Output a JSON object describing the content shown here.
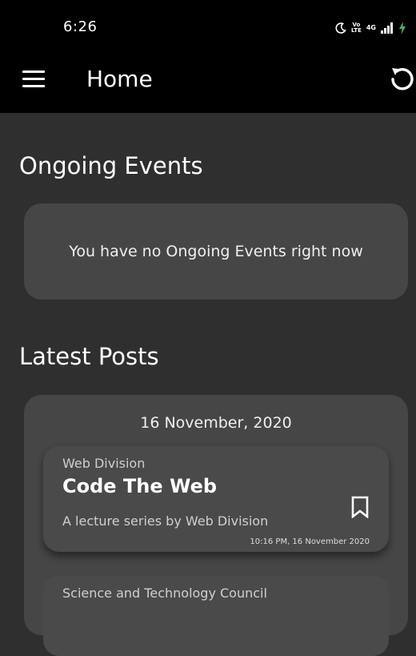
{
  "status_bar": {
    "time": "6:26",
    "icons": [
      "moon-icon",
      "volte-icon",
      "4g-icon",
      "signal-icon",
      "charging-icon"
    ],
    "volte_line1": "Vo",
    "volte_line2": "LTE",
    "network": "4G"
  },
  "app_bar": {
    "title": "Home"
  },
  "ongoing": {
    "section_title": "Ongoing Events",
    "empty_message": "You have no Ongoing Events right now"
  },
  "latest": {
    "section_title": "Latest Posts",
    "date": "16 November, 2020",
    "posts": [
      {
        "division": "Web Division",
        "title": "Code The Web",
        "description": "A lecture series by Web Division",
        "timestamp": "10:16 PM, 16 November 2020"
      },
      {
        "division": "Science and Technology Council"
      }
    ]
  },
  "colors": {
    "background": "#2f2f2f",
    "bar": "#000000",
    "card": "#464646",
    "charging": "#4caf50"
  }
}
